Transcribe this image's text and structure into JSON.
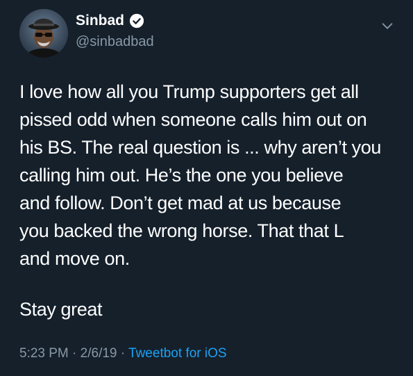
{
  "user": {
    "display_name": "Sinbad",
    "handle": "@sinbadbad",
    "verified": true
  },
  "icons": {
    "verified": "verified-badge-icon",
    "caret": "chevron-down-icon"
  },
  "tweet": {
    "lines": [
      "I love how all you Trump  supporters get all",
      "pissed odd when someone calls him out on",
      "his BS. The real question is ... why aren’t you",
      "calling him out. He’s the one you believe",
      "and follow. Don’t get mad at us because",
      "you backed the wrong horse. That that L",
      "and move on."
    ],
    "closing": "Stay great"
  },
  "meta": {
    "time": "5:23 PM",
    "separator1": " · ",
    "date": "2/6/19",
    "separator2": " · ",
    "source": "Tweetbot for iOS"
  },
  "colors": {
    "background": "#15202b",
    "text": "#ffffff",
    "muted": "#8899a6",
    "accent": "#1da1f2"
  }
}
